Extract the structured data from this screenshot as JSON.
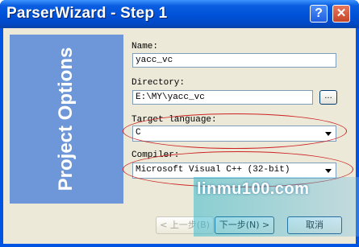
{
  "window": {
    "title": "ParserWizard - Step 1",
    "help_label": "?",
    "close_label": "✕"
  },
  "banner": {
    "text": "Project Options"
  },
  "form": {
    "name": {
      "label": "Name:",
      "value": "yacc_vc"
    },
    "directory": {
      "label": "Directory:",
      "value": "E:\\MY\\yacc_vc",
      "browse_label": "..."
    },
    "target_language": {
      "label": "Target language:",
      "value": "C"
    },
    "compiler": {
      "label": "Compiler:",
      "value": "Microsoft Visual C++ (32-bit)"
    }
  },
  "buttons": {
    "back": "< 上一步(B)",
    "next": "下一步(N) >",
    "cancel": "取消"
  },
  "watermark": {
    "text": "linmu100.com"
  },
  "colors": {
    "banner": "#6d97d8",
    "titlebar": "#0054e3",
    "annotation": "#cc2222"
  }
}
